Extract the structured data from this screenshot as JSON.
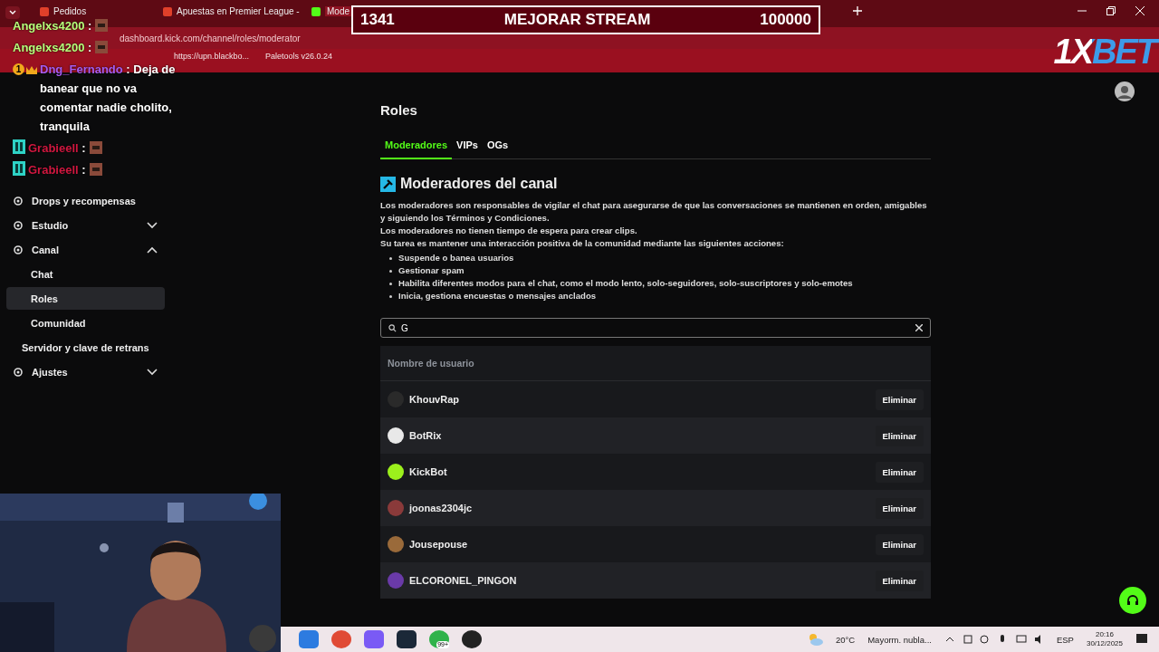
{
  "browser": {
    "tabs": [
      {
        "title": "Pedidos",
        "selected": false
      },
      {
        "title": "Apuestas en Premier League -",
        "selected": false
      },
      {
        "title": "Mode",
        "selected": true
      }
    ],
    "url": "dashboard.kick.com/channel/roles/moderator",
    "bookmarks": [
      "https://upn.blackbo...",
      "Paletools v26.0.24"
    ]
  },
  "sidebar": {
    "items": [
      {
        "label": "Drops y recompensas"
      },
      {
        "label": "Estudio",
        "expanded": false
      },
      {
        "label": "Canal",
        "expanded": true,
        "children": [
          {
            "label": "Chat",
            "selected": false
          },
          {
            "label": "Roles",
            "selected": true
          },
          {
            "label": "Comunidad",
            "selected": false
          }
        ]
      },
      {
        "label": "Servidor y clave de retrans",
        "kind": "plain"
      },
      {
        "label": "Ajustes",
        "expanded": false
      }
    ]
  },
  "page": {
    "title": "Roles",
    "tabs": [
      {
        "label": "Moderadores",
        "selected": true
      },
      {
        "label": "VIPs",
        "selected": false
      },
      {
        "label": "OGs",
        "selected": false
      }
    ],
    "section_title": "Moderadores del canal",
    "description": [
      "Los moderadores son responsables de vigilar el chat para asegurarse de que las conversaciones se mantienen en orden, amigables y siguiendo los Términos y Condiciones.",
      "Los moderadores no tienen tiempo de espera para crear clips.",
      "Su tarea es mantener una interacción positiva de la comunidad mediante las siguientes acciones:"
    ],
    "actions": [
      "Suspende o banea usuarios",
      "Gestionar spam",
      "Habilita diferentes modos para el chat, como el modo lento, solo-seguidores, solo-suscriptores y solo-emotes",
      "Inicia, gestiona encuestas o mensajes anclados"
    ],
    "search": {
      "value": "G"
    },
    "table": {
      "column": "Nombre de usuario",
      "rows": [
        {
          "username": "KhouvRap",
          "color": "#2a2a2a",
          "action": "Eliminar"
        },
        {
          "username": "BotRix",
          "color": "#e8e8e8",
          "action": "Eliminar"
        },
        {
          "username": "KickBot",
          "color": "#9cf01c",
          "action": "Eliminar"
        },
        {
          "username": "joonas2304jc",
          "color": "#8a3a3a",
          "action": "Eliminar"
        },
        {
          "username": "Jousepouse",
          "color": "#9a6a3a",
          "action": "Eliminar"
        },
        {
          "username": "ELCORONEL_PINGON",
          "color": "#6a3aa8",
          "action": "Eliminar"
        }
      ]
    }
  },
  "overlay": {
    "goal": {
      "current": "1341",
      "title": "MEJORAR STREAM",
      "target": "100000"
    },
    "sponsor": "1XBET",
    "chat": [
      {
        "kind": "emote",
        "user": "Angelxs4200",
        "color": "#b8ff7a",
        "sep": ":"
      },
      {
        "kind": "emote",
        "user": "Angelxs4200",
        "color": "#b8ff7a",
        "sep": ":"
      },
      {
        "kind": "badged_text",
        "user": "Dng_Fernando",
        "color": "#a65cf0",
        "sep": ":",
        "text": "Deja de banear que no va comentar nadie cholito, tranquila",
        "badge_number": "1"
      },
      {
        "kind": "og_emote",
        "user": "Grabieell",
        "color": "#d0173f",
        "sep": ":"
      },
      {
        "kind": "og_emote",
        "user": "Grabieell",
        "color": "#d0173f",
        "sep": ":"
      }
    ]
  },
  "taskbar": {
    "weather": {
      "temp": "20°C",
      "text": "Mayorm. nubla..."
    },
    "language": "ESP",
    "time": "20:16",
    "date": "30/12/2025",
    "apps_badge": "99+"
  }
}
